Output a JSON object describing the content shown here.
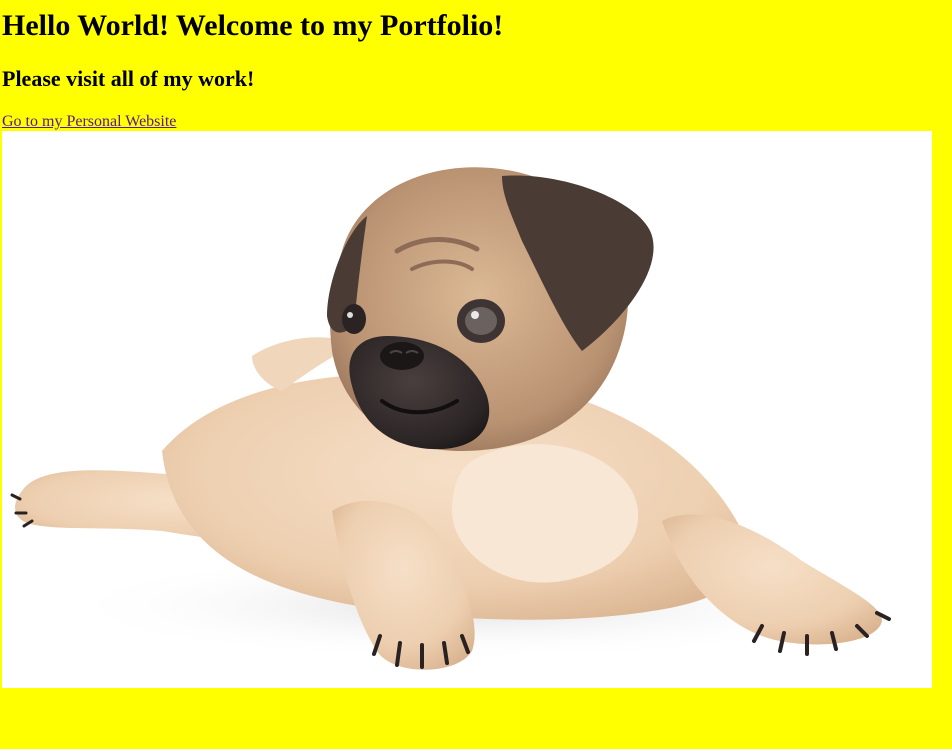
{
  "page": {
    "heading": "Hello World! Welcome to my Portfolio!",
    "subheading": "Please visit all of my work!",
    "link_text": "Go to my Personal Website",
    "image_subject": "pug-puppy-photo"
  },
  "colors": {
    "background": "#ffff00",
    "link": "#551a8b",
    "photo_background": "#ffffff"
  }
}
